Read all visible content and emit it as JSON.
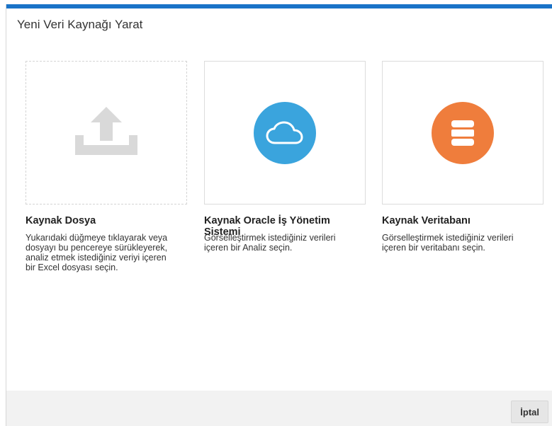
{
  "dialog": {
    "title": "Yeni Veri Kaynağı Yarat",
    "accent_color": "#1a73c8"
  },
  "cards": [
    {
      "title": "Kaynak Dosya",
      "description": "Yukarıdaki düğmeye tıklayarak veya dosyayı bu pencereye sürükleyerek, analiz etmek istediğiniz veriyi içeren bir Excel dosyası seçin.",
      "icon": "upload-icon",
      "icon_color": "#d9d9d9"
    },
    {
      "title": "Kaynak Oracle İş Yönetim Sistemi",
      "description": "Görselleştirmek istediğiniz verileri içeren bir Analiz seçin.",
      "icon": "cloud-icon",
      "icon_color": "#3aa4dd"
    },
    {
      "title": "Kaynak Veritabanı",
      "description": "Görselleştirmek istediğiniz verileri içeren bir veritabanı seçin.",
      "icon": "database-icon",
      "icon_color": "#ef7d3c"
    }
  ],
  "footer": {
    "cancel_label": "İptal"
  }
}
